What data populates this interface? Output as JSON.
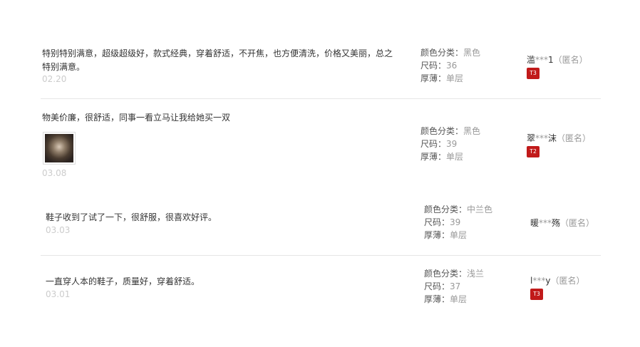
{
  "reviews": [
    {
      "content": "特别特别满意，超级超级好，款式经典，穿着舒适，不开焦，也方便清洗，价格又美丽，总之特别满意。",
      "date": "02.20",
      "specs": [
        {
          "label": "颜色分类：",
          "value": "黑色"
        },
        {
          "label": "尺码：",
          "value": "36"
        },
        {
          "label": "厚薄：",
          "value": "单层"
        }
      ],
      "user": {
        "first": "滥",
        "mask": "***",
        "last": "1",
        "anon": "（匿名）",
        "badge": "T3"
      }
    },
    {
      "content": "物美价廉，很舒适，同事一看立马让我给她买一双",
      "date": "03.08",
      "specs": [
        {
          "label": "颜色分类：",
          "value": "黑色"
        },
        {
          "label": "尺码：",
          "value": "39"
        },
        {
          "label": "厚薄：",
          "value": "单层"
        }
      ],
      "user": {
        "first": "翠",
        "mask": "***",
        "last": "沫",
        "anon": "（匿名）",
        "badge": "T2"
      }
    },
    {
      "content": "鞋子收到了试了一下，很舒服，很喜欢好评。",
      "date": "03.03",
      "specs": [
        {
          "label": "颜色分类：",
          "value": "中兰色"
        },
        {
          "label": "尺码：",
          "value": "39"
        },
        {
          "label": "厚薄：",
          "value": "单层"
        }
      ],
      "user": {
        "first": "暖",
        "mask": "***",
        "last": "殇",
        "anon": "（匿名）",
        "badge": ""
      }
    },
    {
      "content": "一直穿人本的鞋子，质量好，穿着舒适。",
      "date": "03.01",
      "specs": [
        {
          "label": "颜色分类：",
          "value": "浅兰"
        },
        {
          "label": "尺码：",
          "value": "37"
        },
        {
          "label": "厚薄：",
          "value": "单层"
        }
      ],
      "user": {
        "first": "l",
        "mask": "***",
        "last": "y",
        "anon": "（匿名）",
        "badge": "T3"
      }
    }
  ],
  "colors": {
    "badge": "#c11a1a",
    "muted": "#999999",
    "date": "#cccccc"
  },
  "icons": {
    "photo": "review-photo-thumbnail",
    "badge": "user-level-badge"
  }
}
